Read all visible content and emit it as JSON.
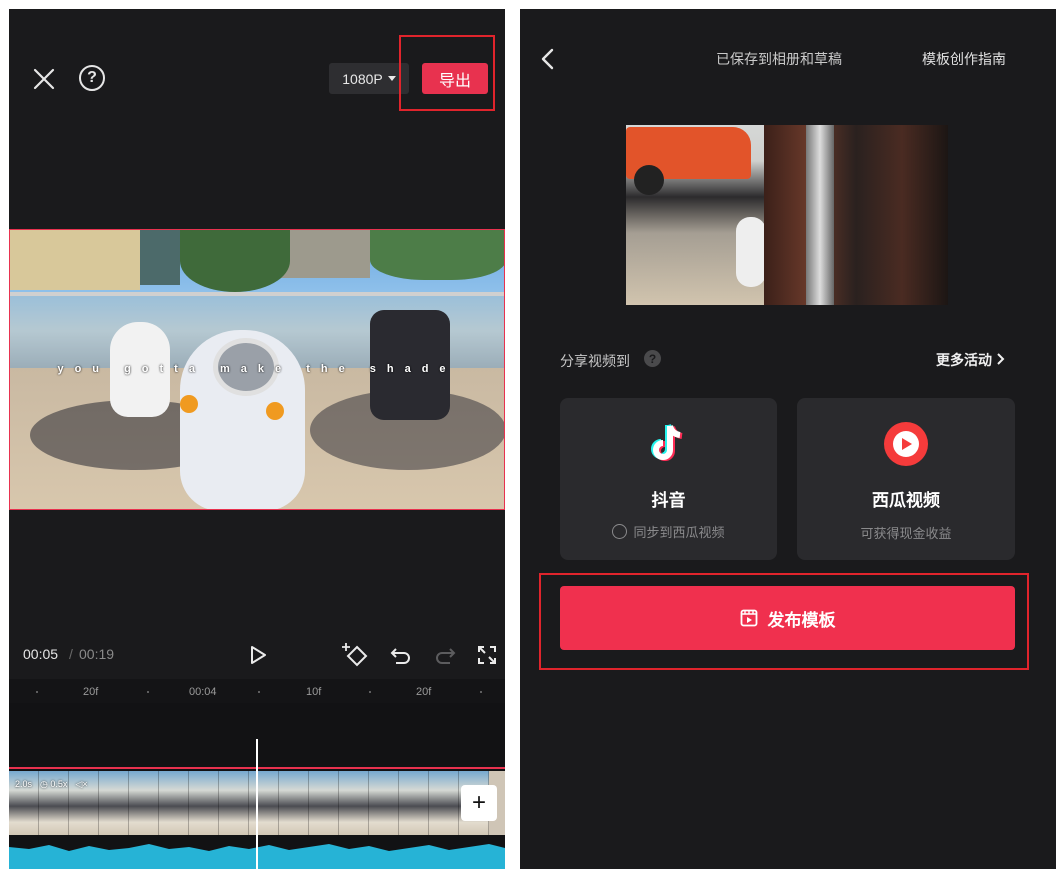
{
  "left_screen": {
    "header": {
      "close_icon": "close-icon",
      "help_icon": "help-icon",
      "help_glyph": "?",
      "resolution": "1080P",
      "export_label": "导出"
    },
    "preview": {
      "caption": "you gotta make the shade"
    },
    "playback": {
      "current_time": "00:05",
      "separator": "/",
      "total_time": "00:19"
    },
    "ruler": {
      "labels": [
        "20f",
        "00:04",
        "10f",
        "20f"
      ]
    },
    "clip": {
      "duration": "2.0s",
      "speed": "0.5x",
      "add_glyph": "+"
    }
  },
  "right_screen": {
    "header": {
      "saved_status": "已保存到相册和草稿",
      "guide_link": "模板创作指南"
    },
    "share": {
      "label": "分享视频到",
      "help_glyph": "?",
      "more_activities": "更多活动"
    },
    "platforms": [
      {
        "name": "抖音",
        "sub": "同步到西瓜视频"
      },
      {
        "name": "西瓜视频",
        "sub": "可获得现金收益"
      }
    ],
    "publish_label": "发布模板"
  },
  "colors": {
    "accent": "#e8324f",
    "highlight_box": "#e0242c",
    "background": "#1a1a1c",
    "card": "#2a2a2d",
    "audio_wave": "#26b3d6"
  }
}
